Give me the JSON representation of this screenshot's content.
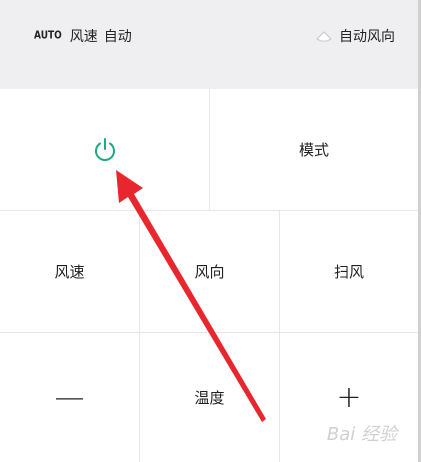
{
  "status": {
    "auto_tag": "AUTO",
    "fan_label": "风速",
    "fan_value": "自动",
    "direction_label": "自动风向",
    "direction_icon": "swing-direction-icon"
  },
  "controls": {
    "power_icon": "power-icon",
    "mode_label": "模式",
    "fan_speed_label": "风速",
    "fan_direction_label": "风向",
    "swing_label": "扫风",
    "minus_symbol": "—",
    "temperature_label": "温度",
    "plus_symbol": "+"
  },
  "colors": {
    "power_accent": "#1fa97e",
    "arrow": "#e8262d",
    "header_bg": "#efeef0"
  },
  "watermark": {
    "text": "Bai 经验"
  }
}
